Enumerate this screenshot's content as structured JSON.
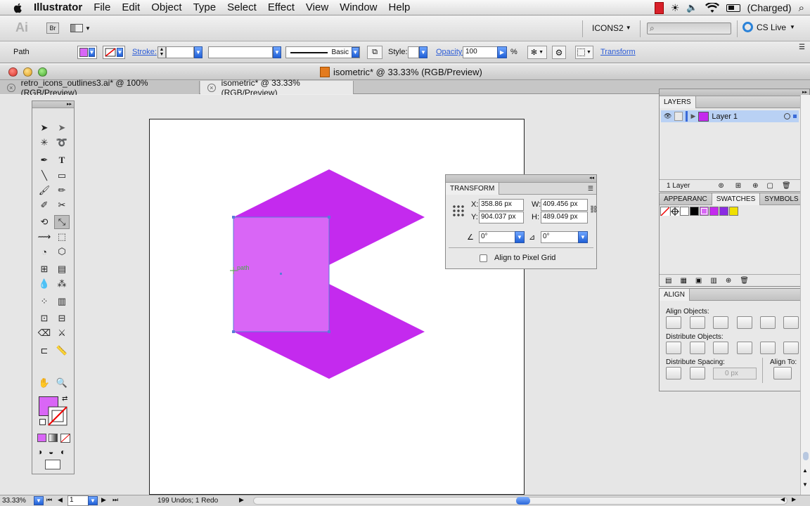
{
  "menubar": {
    "app_name": "Illustrator",
    "items": [
      "File",
      "Edit",
      "Object",
      "Type",
      "Select",
      "Effect",
      "View",
      "Window",
      "Help"
    ],
    "battery": "(Charged)"
  },
  "appbar": {
    "ai_logo": "Ai",
    "bridge": "Br",
    "workspace": "ICONS2",
    "cs_live": "CS Live"
  },
  "control_bar": {
    "selection_type": "Path",
    "stroke_label": "Stroke:",
    "brush_label": "Basic",
    "style_label": "Style:",
    "opacity_label": "Opacity:",
    "opacity_value": "100",
    "percent": "%",
    "transform_link": "Transform"
  },
  "window": {
    "title": "isometric* @ 33.33% (RGB/Preview)",
    "tabs": [
      {
        "label": "retro_icons_outlines3.ai* @ 100% (RGB/Preview)",
        "active": false
      },
      {
        "label": "isometric* @ 33.33% (RGB/Preview)",
        "active": true
      }
    ]
  },
  "canvas": {
    "path_label": "path",
    "colors": {
      "shape": "#c42aee",
      "selected_face": "#d966f6",
      "selection": "#5a7bd8"
    }
  },
  "transform_panel": {
    "title": "TRANSFORM",
    "x_label": "X:",
    "x_value": "358.86 px",
    "y_label": "Y:",
    "y_value": "904.037 px",
    "w_label": "W:",
    "w_value": "409.456 px",
    "h_label": "H:",
    "h_value": "489.049 px",
    "rotate_value": "0°",
    "shear_value": "0°",
    "align_pixel_label": "Align to Pixel Grid"
  },
  "layers_panel": {
    "title": "LAYERS",
    "layer_name": "Layer 1",
    "layer_count": "1 Layer"
  },
  "swatches_panel": {
    "tabs": [
      "APPEARANC",
      "SWATCHES",
      "SYMBOLS"
    ],
    "swatch_colors": [
      "#ffffff",
      "#000000",
      "#d966f6",
      "#c42aee",
      "#8a2be2",
      "#f0e000"
    ]
  },
  "align_panel": {
    "title": "ALIGN",
    "align_objects": "Align Objects:",
    "distribute_objects": "Distribute Objects:",
    "distribute_spacing": "Distribute Spacing:",
    "align_to": "Align To:",
    "spacing_value": "0 px"
  },
  "status_bar": {
    "zoom": "33.33%",
    "artboard_num": "1",
    "status_text": "199 Undos; 1 Redo"
  },
  "fill_color": "#d966f6"
}
